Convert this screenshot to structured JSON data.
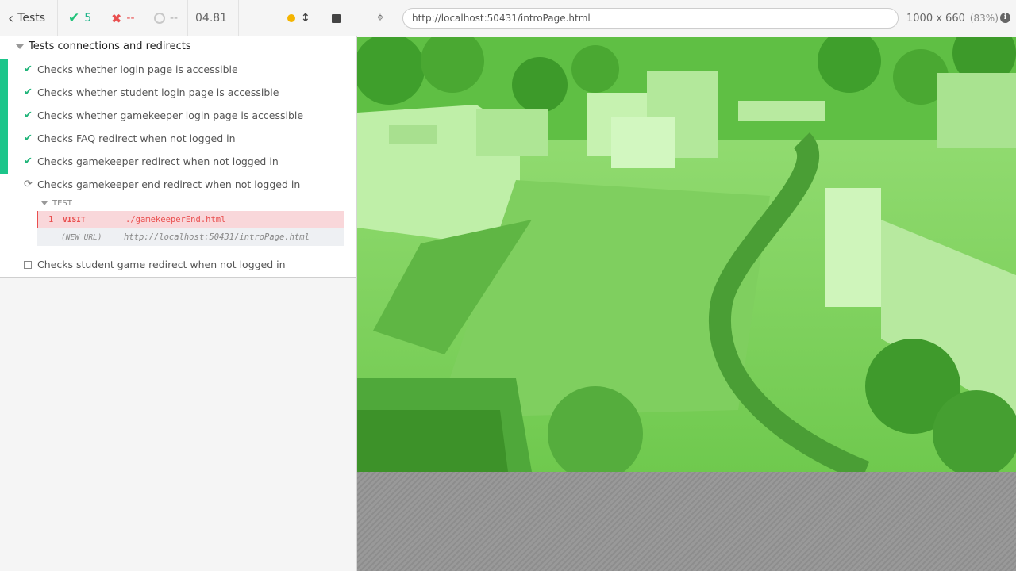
{
  "stats": {
    "back_label": "Tests",
    "passed": "5",
    "failed": "--",
    "pending": "--",
    "duration": "04.81"
  },
  "suite": {
    "title": "Tests connections and redirects",
    "tests": [
      {
        "title": "Checks whether login page is accessible",
        "state": "passed"
      },
      {
        "title": "Checks whether student login page is accessible",
        "state": "passed"
      },
      {
        "title": "Checks whether gamekeeper login page is accessible",
        "state": "passed"
      },
      {
        "title": "Checks FAQ redirect when not logged in",
        "state": "passed"
      },
      {
        "title": "Checks gamekeeper redirect when not logged in",
        "state": "passed"
      },
      {
        "title": "Checks gamekeeper end redirect when not logged in",
        "state": "running"
      },
      {
        "title": "Checks student game redirect when not logged in",
        "state": "pending"
      }
    ],
    "test_section_label": "TEST",
    "commands": [
      {
        "number": "1",
        "name": "VISIT",
        "message": "./gamekeeperEnd.html"
      },
      {
        "number": "",
        "name": "(NEW URL)",
        "message": "http://localhost:50431/introPage.html"
      }
    ]
  },
  "aut": {
    "url": "http://localhost:50431/introPage.html",
    "viewport": "1000 x 660",
    "scale": "(83%)",
    "info_glyph": "i"
  },
  "icons": {
    "back": "chevron-left-icon",
    "passed": "check-icon",
    "failed": "x-icon",
    "pending": "circle-icon",
    "running": "yellow-dot-icon",
    "resize": "arrows-vertical-icon",
    "stop": "stop-icon",
    "selector": "crosshair-icon",
    "info": "info-icon"
  },
  "colors": {
    "passed": "#21c37a",
    "failed": "#e94f4f",
    "running": "#f4b400",
    "overlay": "#6ec94f"
  }
}
